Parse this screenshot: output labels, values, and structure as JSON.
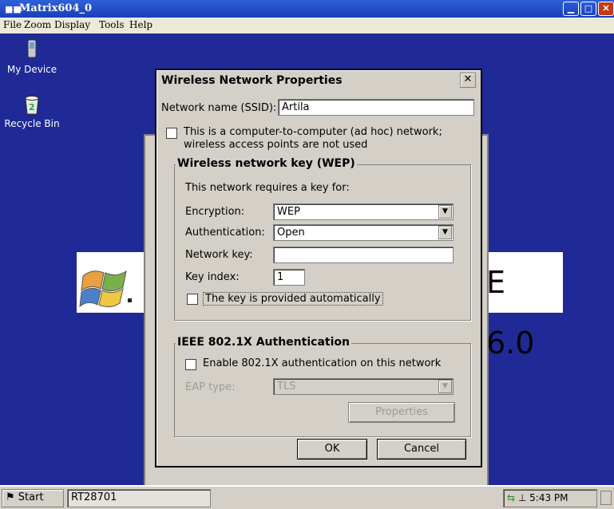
{
  "window": {
    "title": "Matrix604_0",
    "app_icon": "rt-icon",
    "controls": [
      "minimize",
      "maximize",
      "close"
    ]
  },
  "menu": {
    "file": "File",
    "zoom": "Zoom",
    "display": "Display",
    "tools": "Tools",
    "help": "Help"
  },
  "desktop": {
    "icons": [
      {
        "label": "My Device",
        "icon": "my-device-icon"
      },
      {
        "label": "Recycle Bin",
        "icon": "recycle-bin-icon"
      }
    ],
    "brand_fragment": "E 6.0"
  },
  "dialog": {
    "title": "Wireless Network Properties",
    "ssid_label": "Network name (SSID):",
    "ssid_value": "Artila",
    "adhoc_label_line1": "This is a computer-to-computer (ad hoc) network;",
    "adhoc_label_line2": "wireless access points are not used",
    "adhoc_checked": false,
    "wep_group_title": "Wireless network key (WEP)",
    "requires_key_text": "This network requires a key for:",
    "encryption_label": "Encryption:",
    "encryption_value": "WEP",
    "authentication_label": "Authentication:",
    "authentication_value": "Open",
    "network_key_label": "Network key:",
    "network_key_value": "",
    "key_index_label": "Key index:",
    "key_index_value": "1",
    "auto_key_label": "The key is provided automatically",
    "auto_key_checked": false,
    "ieee_group_title": "IEEE 802.1X Authentication",
    "enable_8021x_label": "Enable 802.1X authentication on this network",
    "enable_8021x_checked": false,
    "eap_type_label": "EAP type:",
    "eap_type_value": "TLS",
    "properties_button": "Properties",
    "ok_button": "OK",
    "cancel_button": "Cancel"
  },
  "taskbar": {
    "start_label": "Start",
    "task_label": "RT28701",
    "clock": "5:43 PM"
  },
  "colors": {
    "desktop": "#1f2a96",
    "titlebar": "#1840b8",
    "dialog_face": "#d4d0c8"
  }
}
